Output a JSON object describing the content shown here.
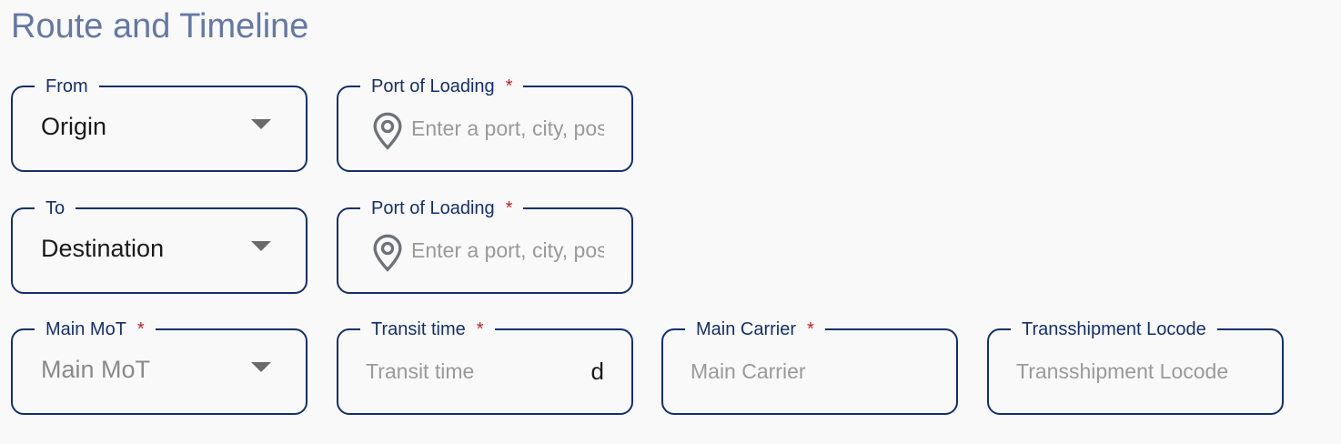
{
  "section": {
    "title": "Route and Timeline"
  },
  "from_field": {
    "label": "From",
    "value": "Origin"
  },
  "from_port": {
    "label": "Port of Loading",
    "required_mark": "*",
    "placeholder": "Enter a port, city, postal code"
  },
  "to_field": {
    "label": "To",
    "value": "Destination"
  },
  "to_port": {
    "label": "Port of Loading",
    "required_mark": "*",
    "placeholder": "Enter a port, city, postal code"
  },
  "main_mot": {
    "label": "Main MoT",
    "required_mark": "*",
    "placeholder": "Main MoT"
  },
  "transit_time": {
    "label": "Transit time",
    "required_mark": "*",
    "placeholder": "Transit time",
    "suffix": "d"
  },
  "main_carrier": {
    "label": "Main Carrier",
    "required_mark": "*",
    "placeholder": "Main Carrier"
  },
  "transshipment": {
    "label": "Transshipment Locode",
    "placeholder": "Transshipment Locode"
  },
  "colors": {
    "title": "#6578a5",
    "border": "#14306b",
    "required": "#c21f1f",
    "placeholder": "#9a9a9a",
    "background": "#f9f9fa"
  }
}
